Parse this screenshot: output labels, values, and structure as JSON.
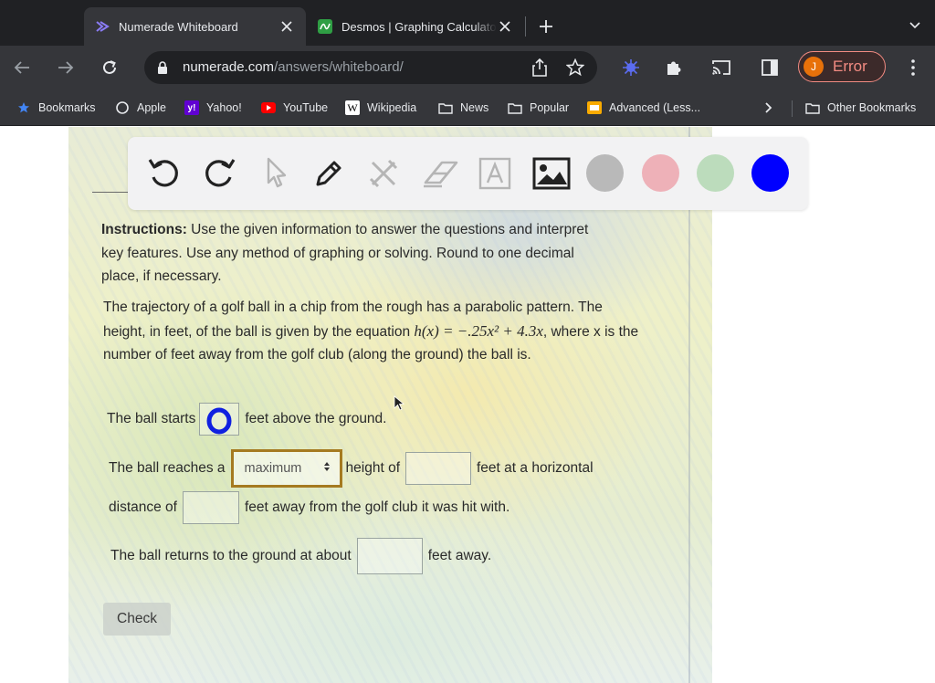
{
  "browser": {
    "tabs": [
      {
        "title": "Numerade Whiteboard",
        "favicon": "numerade-icon",
        "active": true
      },
      {
        "title": "Desmos | Graphing Calculator",
        "favicon": "desmos-icon",
        "active": false
      }
    ],
    "url_host": "numerade.com",
    "url_path": "/answers/whiteboard/",
    "profile_initial": "J",
    "profile_status": "Error",
    "bookmarks": [
      {
        "label": "Bookmarks",
        "icon": "star-icon"
      },
      {
        "label": "Apple",
        "icon": "apple-icon"
      },
      {
        "label": "Yahoo!",
        "icon": "yahoo-icon"
      },
      {
        "label": "YouTube",
        "icon": "youtube-icon"
      },
      {
        "label": "Wikipedia",
        "icon": "wikipedia-icon"
      },
      {
        "label": "News",
        "icon": "folder-icon"
      },
      {
        "label": "Popular",
        "icon": "folder-icon"
      },
      {
        "label": "Advanced (Less...",
        "icon": "bookmark-page-icon"
      },
      {
        "label": "Other Bookmarks",
        "icon": "folder-icon"
      }
    ]
  },
  "whiteboard": {
    "tools": [
      "undo-icon",
      "redo-icon",
      "pointer-icon",
      "pen-icon",
      "tools-icon",
      "eraser-icon",
      "text-icon",
      "image-icon"
    ],
    "colors": [
      "#b9b9b9",
      "#eeb1b8",
      "#bcdcbc",
      "#0000ff"
    ]
  },
  "worksheet": {
    "instructions_label": "Instructions:",
    "instructions_text": " Use the given information to answer the questions and interpret key features. Use any method of graphing or solving.  Round to one decimal place, if necessary.",
    "problem_text_1": "The trajectory of a golf ball in a chip from the rough has a parabolic pattern. The height, in feet, of the ball is given by the equation",
    "equation": "h(x) = −.25x² + 4.3x",
    "problem_text_2": ", where x is the number of feet away from the golf club (along the ground) the ball is.",
    "q1_before": "The ball starts",
    "q1_answer": "0",
    "q1_after": "feet above the ground.",
    "q2_before": "The ball reaches a",
    "q2_select": "maximum",
    "q2_mid": "height of",
    "q2_after": "feet at a horizontal",
    "q3_before": "distance of",
    "q3_after": "feet away from the golf club it was hit with.",
    "q4_before": "The ball returns to the ground at about",
    "q4_after": "feet away.",
    "check_label": "Check"
  }
}
